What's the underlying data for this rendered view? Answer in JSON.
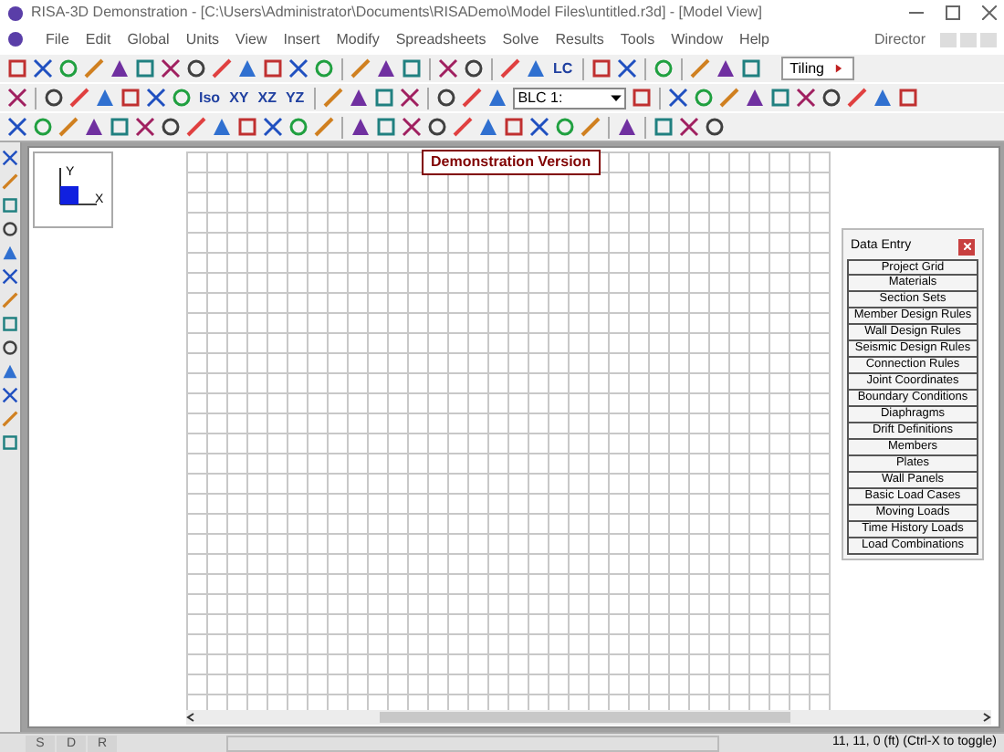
{
  "window": {
    "title": "RISA-3D Demonstration - [C:\\Users\\Administrator\\Documents\\RISADemo\\Model Files\\untitled.r3d] - [Model View]"
  },
  "menu": {
    "items": [
      "File",
      "Edit",
      "Global",
      "Units",
      "View",
      "Insert",
      "Modify",
      "Spreadsheets",
      "Solve",
      "Results",
      "Tools",
      "Window",
      "Help"
    ],
    "right_label": "Director"
  },
  "toolbars": [
    [
      {
        "kind": "icon"
      },
      {
        "kind": "icon"
      },
      {
        "kind": "icon"
      },
      {
        "kind": "icon"
      },
      {
        "kind": "icon"
      },
      {
        "kind": "icon"
      },
      {
        "kind": "icon"
      },
      {
        "kind": "icon"
      },
      {
        "kind": "icon"
      },
      {
        "kind": "icon"
      },
      {
        "kind": "icon"
      },
      {
        "kind": "icon"
      },
      {
        "kind": "icon"
      },
      {
        "kind": "sep"
      },
      {
        "kind": "icon"
      },
      {
        "kind": "icon"
      },
      {
        "kind": "icon"
      },
      {
        "kind": "sep"
      },
      {
        "kind": "icon"
      },
      {
        "kind": "icon"
      },
      {
        "kind": "sep"
      },
      {
        "kind": "icon"
      },
      {
        "kind": "icon"
      },
      {
        "kind": "text",
        "label": "LC"
      },
      {
        "kind": "sep"
      },
      {
        "kind": "icon"
      },
      {
        "kind": "icon"
      },
      {
        "kind": "sep"
      },
      {
        "kind": "icon"
      },
      {
        "kind": "sep"
      },
      {
        "kind": "icon"
      },
      {
        "kind": "icon"
      },
      {
        "kind": "icon"
      },
      {
        "kind": "button",
        "label": "Tiling"
      }
    ],
    [
      {
        "kind": "icon"
      },
      {
        "kind": "sep"
      },
      {
        "kind": "icon"
      },
      {
        "kind": "icon"
      },
      {
        "kind": "icon"
      },
      {
        "kind": "icon"
      },
      {
        "kind": "icon"
      },
      {
        "kind": "icon"
      },
      {
        "kind": "text",
        "label": "Iso"
      },
      {
        "kind": "text",
        "label": "XY"
      },
      {
        "kind": "text",
        "label": "XZ"
      },
      {
        "kind": "text",
        "label": "YZ"
      },
      {
        "kind": "sep"
      },
      {
        "kind": "icon"
      },
      {
        "kind": "icon"
      },
      {
        "kind": "icon"
      },
      {
        "kind": "icon"
      },
      {
        "kind": "sep"
      },
      {
        "kind": "icon"
      },
      {
        "kind": "icon"
      },
      {
        "kind": "icon"
      },
      {
        "kind": "dropdown",
        "label": "BLC 1:"
      },
      {
        "kind": "icon"
      },
      {
        "kind": "sep"
      },
      {
        "kind": "icon"
      },
      {
        "kind": "icon"
      },
      {
        "kind": "icon"
      },
      {
        "kind": "icon"
      },
      {
        "kind": "icon"
      },
      {
        "kind": "icon"
      },
      {
        "kind": "icon"
      },
      {
        "kind": "icon"
      },
      {
        "kind": "icon"
      },
      {
        "kind": "icon"
      }
    ],
    [
      {
        "kind": "icon"
      },
      {
        "kind": "icon"
      },
      {
        "kind": "icon"
      },
      {
        "kind": "icon"
      },
      {
        "kind": "icon"
      },
      {
        "kind": "icon"
      },
      {
        "kind": "icon"
      },
      {
        "kind": "icon"
      },
      {
        "kind": "icon"
      },
      {
        "kind": "icon"
      },
      {
        "kind": "icon"
      },
      {
        "kind": "icon"
      },
      {
        "kind": "icon"
      },
      {
        "kind": "sep"
      },
      {
        "kind": "icon"
      },
      {
        "kind": "icon"
      },
      {
        "kind": "icon"
      },
      {
        "kind": "icon"
      },
      {
        "kind": "icon"
      },
      {
        "kind": "icon"
      },
      {
        "kind": "icon"
      },
      {
        "kind": "icon"
      },
      {
        "kind": "icon"
      },
      {
        "kind": "icon"
      },
      {
        "kind": "sep"
      },
      {
        "kind": "icon"
      },
      {
        "kind": "sep"
      },
      {
        "kind": "icon"
      },
      {
        "kind": "icon"
      },
      {
        "kind": "icon"
      }
    ]
  ],
  "view": {
    "banner": "Demonstration Version",
    "axis_labels": [
      "Y",
      "X"
    ]
  },
  "data_entry": {
    "title": "Data Entry",
    "buttons": [
      "Project Grid",
      "Materials",
      "Section Sets",
      "Member Design Rules",
      "Wall Design Rules",
      "Seismic Design Rules",
      "Connection Rules",
      "Joint Coordinates",
      "Boundary Conditions",
      "Diaphragms",
      "Drift Definitions",
      "Members",
      "Plates",
      "Wall Panels",
      "Basic Load Cases",
      "Moving Loads",
      "Time History Loads",
      "Load Combinations"
    ]
  },
  "status_bar": {
    "tabs": [
      "S",
      "D",
      "R"
    ],
    "coordinates": "11, 11, 0 (ft)  (Ctrl-X to toggle)"
  }
}
